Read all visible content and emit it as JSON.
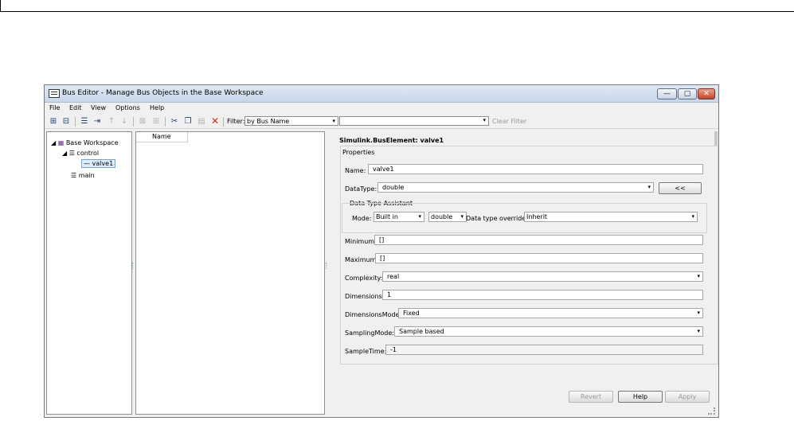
{
  "window": {
    "title": "Bus Editor - Manage Bus Objects in the Base Workspace",
    "controls": {
      "minimize": "—",
      "maximize": "▢",
      "close": "✕"
    }
  },
  "menu": [
    "File",
    "Edit",
    "View",
    "Options",
    "Help"
  ],
  "toolbar": {
    "filter_label": "Filter:",
    "filter_mode": "by Bus Name",
    "filter_text": "",
    "clear_filter": "Clear Filter",
    "icons": [
      "new-bus-icon",
      "new-bus-element-icon",
      "insert-bus-element-icon",
      "add-element-icon",
      "move-up-icon",
      "move-down-icon",
      "expand-icon",
      "collapse-icon",
      "cut-icon",
      "copy-icon",
      "paste-icon",
      "delete-icon"
    ]
  },
  "tree": {
    "root": "Base Workspace",
    "nodes": [
      {
        "label": "control"
      },
      {
        "label": "valve1"
      },
      {
        "label": "main"
      }
    ]
  },
  "list": {
    "column_name": "Name"
  },
  "properties": {
    "header": "Simulink.BusElement: valve1",
    "group_label": "Properties",
    "name_label": "Name:",
    "name_value": "valve1",
    "datatype_label": "DataType:",
    "datatype_value": "double",
    "assistant_button": "<<",
    "assistant_label": "Data Type Assistant",
    "mode_label": "Mode:",
    "mode_value": "Built in",
    "builtin_value": "double",
    "override_label": "Data type override:",
    "override_value": "Inherit",
    "minimum_label": "Minimum:",
    "minimum_value": "[]",
    "maximum_label": "Maximum:",
    "maximum_value": "[]",
    "complexity_label": "Complexity:",
    "complexity_value": "real",
    "dimensions_label": "Dimensions:",
    "dimensions_value": "1",
    "dimensionsmode_label": "DimensionsMode:",
    "dimensionsmode_value": "Fixed",
    "samplingmode_label": "SamplingMode:",
    "samplingmode_value": "Sample based",
    "sampletime_label": "SampleTime:",
    "sampletime_value": "-1"
  },
  "buttons": {
    "revert": "Revert",
    "help": "Help",
    "apply": "Apply"
  },
  "dropdown_arrow": "▾"
}
